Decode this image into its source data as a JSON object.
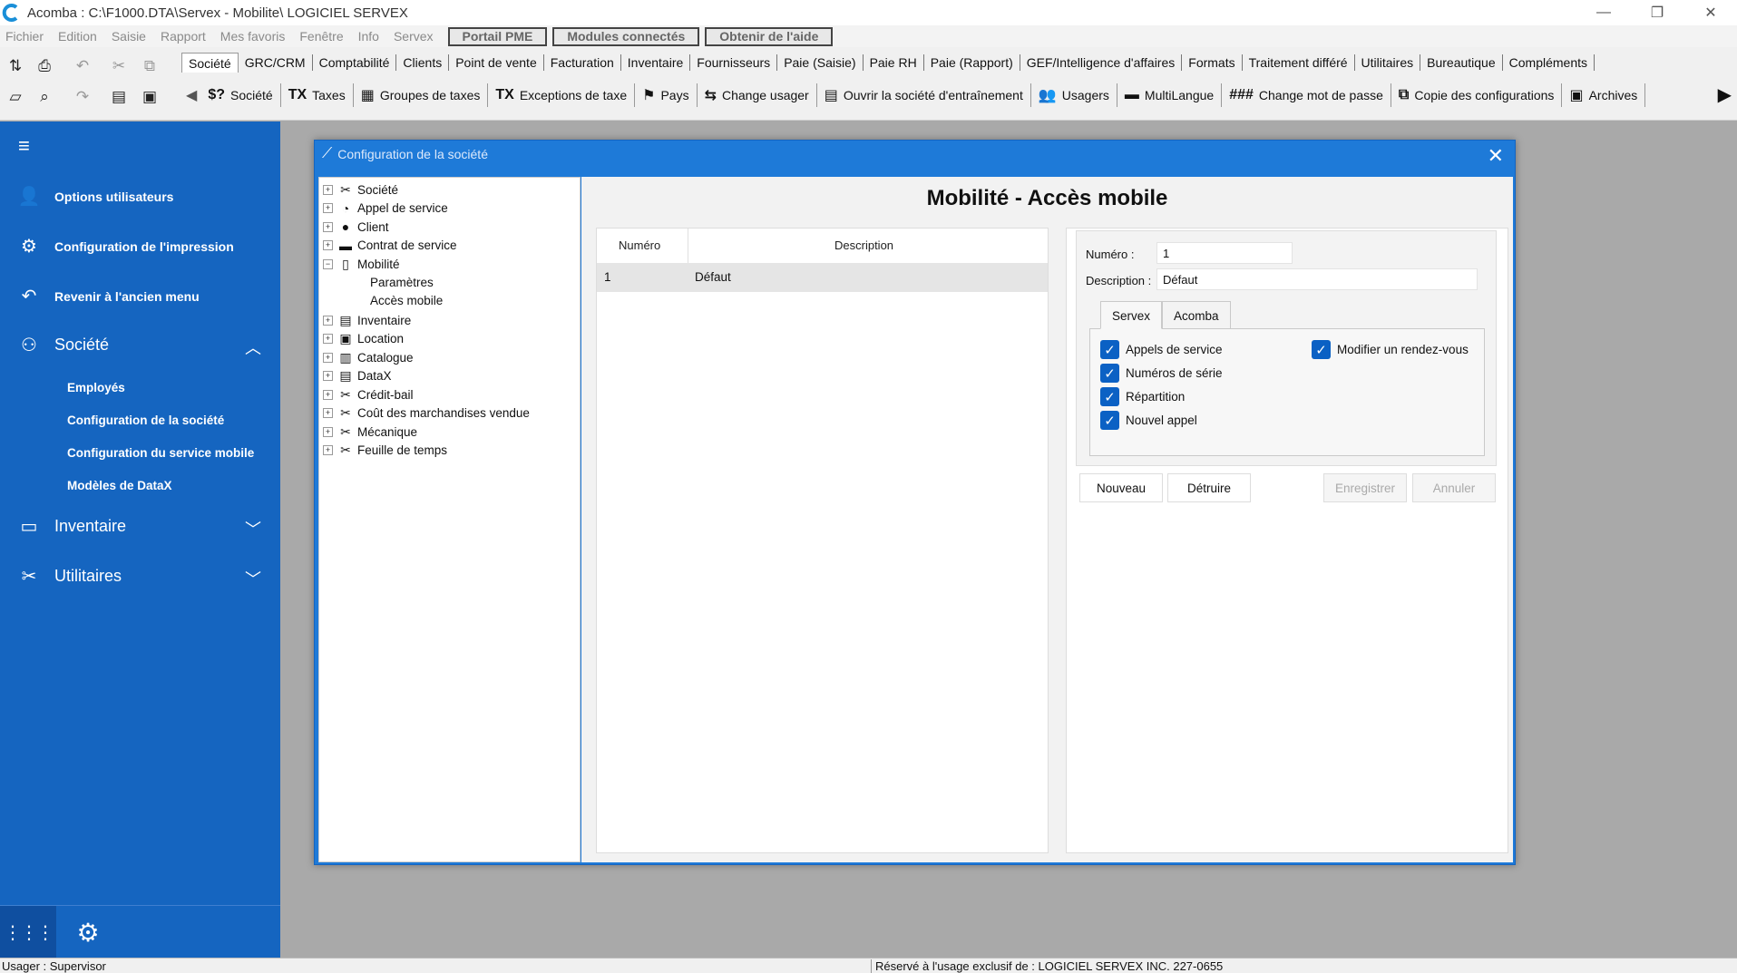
{
  "window": {
    "title": "Acomba : C:\\F1000.DTA\\Servex - Mobilite\\  LOGICIEL SERVEX",
    "minimize": "—",
    "restore": "❐",
    "close": "✕"
  },
  "menubar": {
    "items": [
      "Fichier",
      "Edition",
      "Saisie",
      "Rapport",
      "Mes favoris",
      "Fenêtre",
      "Info",
      "Servex"
    ],
    "buttons": [
      "Portail PME",
      "Modules connectés",
      "Obtenir de l'aide"
    ]
  },
  "ribbon_tabs": [
    "Société",
    "GRC/CRM",
    "Comptabilité",
    "Clients",
    "Point de vente",
    "Facturation",
    "Inventaire",
    "Fournisseurs",
    "Paie (Saisie)",
    "Paie RH",
    "Paie (Rapport)",
    "GEF/Intelligence d'affaires",
    "Formats",
    "Traitement différé",
    "Utilitaires",
    "Bureautique",
    "Compléments"
  ],
  "ribbon_commands": [
    {
      "icon": "$?",
      "label": "Société"
    },
    {
      "icon": "TX",
      "label": "Taxes"
    },
    {
      "icon": "▦",
      "label": "Groupes de taxes"
    },
    {
      "icon": "TX",
      "label": "Exceptions de taxe"
    },
    {
      "icon": "⚑",
      "label": "Pays"
    },
    {
      "icon": "⇆",
      "label": "Change usager"
    },
    {
      "icon": "▤",
      "label": "Ouvrir la société d'entraînement"
    },
    {
      "icon": "👥",
      "label": "Usagers"
    },
    {
      "icon": "▬",
      "label": "MultiLangue"
    },
    {
      "icon": "###",
      "label": "Change mot de passe"
    },
    {
      "icon": "⧉",
      "label": "Copie des configurations"
    },
    {
      "icon": "▣",
      "label": "Archives"
    }
  ],
  "sidebar": {
    "menu_icon": "≡",
    "top_items": [
      {
        "icon": "👤",
        "label": "Options utilisateurs"
      },
      {
        "icon": "⚙",
        "label": "Configuration de l'impression"
      },
      {
        "icon": "↶",
        "label": "Revenir à l'ancien menu"
      }
    ],
    "societe": {
      "icon": "⚇",
      "label": "Société",
      "chevron": "︿"
    },
    "societe_sub": [
      "Employés",
      "Configuration de la société",
      "Configuration du service mobile",
      "Modèles de DataX"
    ],
    "inventaire": {
      "icon": "▭",
      "label": "Inventaire",
      "chevron": "﹀"
    },
    "utilitaires": {
      "icon": "✂",
      "label": "Utilitaires",
      "chevron": "﹀"
    },
    "footer": {
      "apps_icon": "⋮⋮⋮",
      "settings_icon": "⚙"
    }
  },
  "dialog": {
    "title": "Configuration de la société",
    "close": "✕",
    "heading": "Mobilité - Accès mobile",
    "tree": [
      {
        "pm": "+",
        "icon": "✂",
        "label": "Société"
      },
      {
        "pm": "+",
        "icon": "◔",
        "label": "Appel de service"
      },
      {
        "pm": "+",
        "icon": "●",
        "label": "Client"
      },
      {
        "pm": "+",
        "icon": "▬",
        "label": "Contrat de service"
      },
      {
        "pm": "−",
        "icon": "▯",
        "label": "Mobilité"
      },
      {
        "pm": "",
        "icon": "",
        "label": "Paramètres"
      },
      {
        "pm": "",
        "icon": "",
        "label": "Accès mobile"
      },
      {
        "pm": "+",
        "icon": "▤",
        "label": "Inventaire"
      },
      {
        "pm": "+",
        "icon": "▣",
        "label": "Location"
      },
      {
        "pm": "+",
        "icon": "▥",
        "label": "Catalogue"
      },
      {
        "pm": "+",
        "icon": "▤",
        "label": "DataX"
      },
      {
        "pm": "+",
        "icon": "✂",
        "label": "Crédit-bail"
      },
      {
        "pm": "+",
        "icon": "✂",
        "label": "Coût des marchandises vendue"
      },
      {
        "pm": "+",
        "icon": "✂",
        "label": "Mécanique"
      },
      {
        "pm": "+",
        "icon": "✂",
        "label": "Feuille de temps"
      }
    ],
    "grid": {
      "columns": [
        "Numéro",
        "Description"
      ],
      "rows": [
        {
          "numero": "1",
          "description": "Défaut"
        }
      ]
    },
    "detail": {
      "numero_label": "Numéro :",
      "numero_value": "1",
      "description_label": "Description :",
      "description_value": "Défaut",
      "tabs": [
        "Servex",
        "Acomba"
      ],
      "checkboxes_left": [
        "Appels de service",
        "Numéros de série",
        "Répartition",
        "Nouvel appel"
      ],
      "checkboxes_right": [
        "Modifier un rendez-vous"
      ],
      "check_mark": "✓",
      "buttons": [
        "Nouveau",
        "Détruire",
        "Enregistrer",
        "Annuler"
      ]
    }
  },
  "statusbar": {
    "user": "Usager : Supervisor",
    "license": "Réservé à l'usage exclusif de : LOGICIEL SERVEX INC. 227-0655"
  },
  "colors": {
    "sidebar": "#1565c0",
    "dialog_frame": "#1e7ad8",
    "checkbox": "#0b61c4"
  }
}
